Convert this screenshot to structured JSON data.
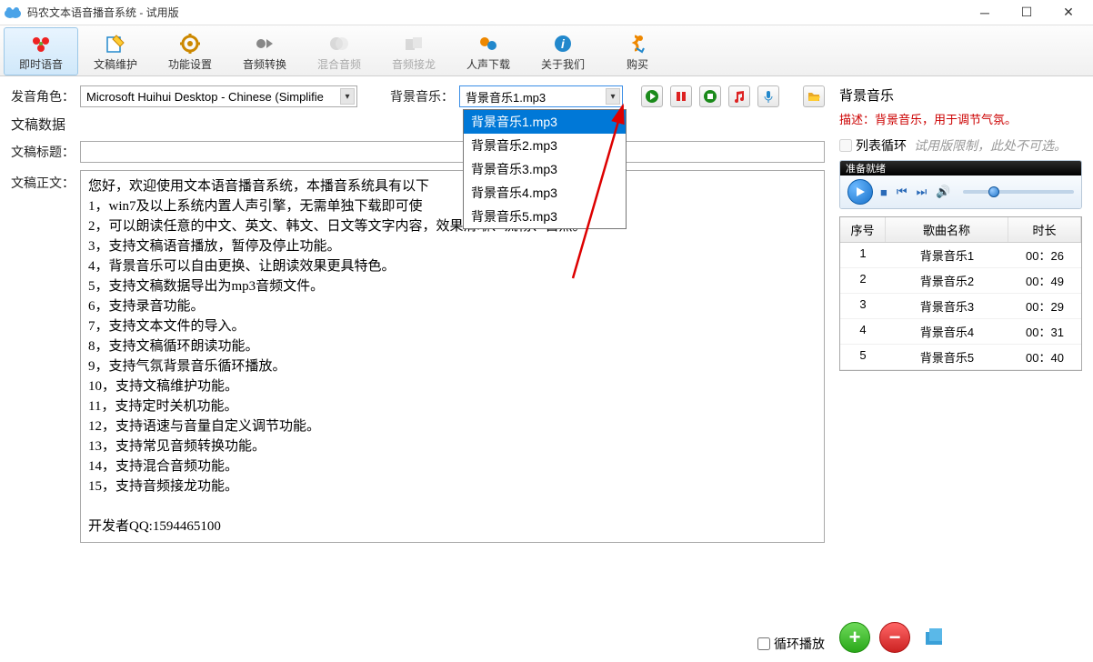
{
  "window": {
    "title": "码农文本语音播音系统 - 试用版"
  },
  "toolbar": [
    {
      "label": "即时语音",
      "active": true
    },
    {
      "label": "文稿维护"
    },
    {
      "label": "功能设置"
    },
    {
      "label": "音频转换"
    },
    {
      "label": "混合音频",
      "disabled": true
    },
    {
      "label": "音频接龙",
      "disabled": true
    },
    {
      "label": "人声下载"
    },
    {
      "label": "关于我们"
    },
    {
      "label": "购买"
    }
  ],
  "left": {
    "voice_label": "发音角色：",
    "voice_value": "Microsoft Huihui Desktop - Chinese (Simplifie",
    "bg_label": "背景音乐：",
    "bg_value": "背景音乐1.mp3",
    "bg_options": [
      "背景音乐1.mp3",
      "背景音乐2.mp3",
      "背景音乐3.mp3",
      "背景音乐4.mp3",
      "背景音乐5.mp3"
    ],
    "data_section": "文稿数据",
    "title_label": "文稿标题：",
    "title_value": "",
    "body_label": "文稿正文：",
    "body_text": "您好，欢迎使用文本语音播音系统，本播音系统具有以下\n1，win7及以上系统内置人声引擎，无需单独下载即可使\n2，可以朗读任意的中文、英文、韩文、日文等文字内容，效果清晰、流畅、自然。\n3，支持文稿语音播放，暂停及停止功能。\n4，背景音乐可以自由更换、让朗读效果更具特色。\n5，支持文稿数据导出为mp3音频文件。\n6，支持录音功能。\n7，支持文本文件的导入。\n8，支持文稿循环朗读功能。\n9，支持气氛背景音乐循环播放。\n10，支持文稿维护功能。\n11，支持定时关机功能。\n12，支持语速与音量自定义调节功能。\n13，支持常见音频转换功能。\n14，支持混合音频功能。\n15，支持音频接龙功能。\n\n开发者QQ:1594465100",
    "loop_label": "循环播放"
  },
  "right": {
    "title": "背景音乐",
    "desc": "描述：背景音乐，用于调节气氛。",
    "loop_list": "列表循环",
    "loop_hint": "试用版限制，此处不可选。",
    "player_status": "准备就绪",
    "table": {
      "headers": [
        "序号",
        "歌曲名称",
        "时长"
      ],
      "rows": [
        {
          "idx": "1",
          "name": "背景音乐1",
          "dur": "00：26"
        },
        {
          "idx": "2",
          "name": "背景音乐2",
          "dur": "00：49"
        },
        {
          "idx": "3",
          "name": "背景音乐3",
          "dur": "00：29"
        },
        {
          "idx": "4",
          "name": "背景音乐4",
          "dur": "00：31"
        },
        {
          "idx": "5",
          "name": "背景音乐5",
          "dur": "00：40"
        }
      ]
    }
  }
}
